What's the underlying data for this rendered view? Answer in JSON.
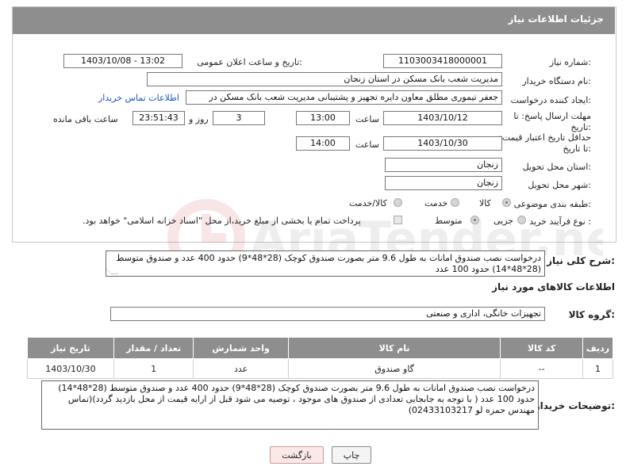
{
  "header": {
    "title": "جزئیات اطلاعات نیاز"
  },
  "fields": {
    "need_number_label": "شماره نیاز:",
    "need_number": "1103003418000001",
    "announce_label": "تاریخ و ساعت اعلان عمومی:",
    "announce_value": "1403/10/08 - 13:02",
    "buyer_label": "نام دستگاه خریدار:",
    "buyer_value": "مدیریت شعب بانک مسکن در استان زنجان",
    "creator_label": "ایجاد کننده درخواست:",
    "creator_value": "جعفر تیموری مطلق معاون دایره تجهیز و پشتیبانی مدیریت شعب بانک مسکن در",
    "contact_link": "اطلاعات تماس خریدار",
    "deadline_label": "مهلت ارسال پاسخ: تا تاریخ:",
    "deadline_date": "1403/10/12",
    "time_label": "ساعت",
    "deadline_time": "13:00",
    "days_value": "3",
    "days_label": "روز و",
    "remaining_time": "23:51:43",
    "remaining_label": "ساعت باقی مانده",
    "validity_label": "حداقل تاریخ اعتبار قیمت: تا تاریخ:",
    "validity_date": "1403/10/30",
    "validity_time": "14:00",
    "province_label": "استان محل تحویل:",
    "province_value": "زنجان",
    "city_label": "شهر محل تحویل:",
    "city_value": "زنجان",
    "category_label": "طبقه بندی موضوعی:",
    "category_options": [
      "کالا",
      "خدمت",
      "کالا/خدمت"
    ],
    "category_selected": "کالا",
    "process_label": "نوع فرآیند خرید :",
    "process_options": [
      "جزیی",
      "متوسط"
    ],
    "process_selected": "متوسط",
    "payment_note": "پرداخت تمام یا بخشی از مبلغ خرید،از محل \"اسناد خزانه اسلامی\" خواهد بود."
  },
  "summary": {
    "label": "شرح کلی نیاز:",
    "text": "درخواست نصب صندوق امانات به طول 9.6 متر بصورت صندوق کوچک (28*48*9) حدود 400 عدد و صندوق متوسط (28*48*14) حدود 100 عدد"
  },
  "goods_info_title": "اطلاعات کالاهای مورد نیاز",
  "goods_group": {
    "label": "گروه کالا:",
    "value": "تجهیزات خانگی، اداری و صنعتی"
  },
  "table": {
    "headers": [
      "ردیف",
      "کد کالا",
      "نام کالا",
      "واحد شمارش",
      "تعداد / مقدار",
      "تاریخ نیاز"
    ],
    "rows": [
      [
        "1",
        "--",
        "گاو صندوق",
        "عدد",
        "1",
        "1403/10/30"
      ]
    ]
  },
  "buyer_notes": {
    "label": "توضیحات خریدار:",
    "text": "درخواست نصب صندوق امانات به طول 9.6 متر بصورت صندوق کوچک (28*48*9) حدود 400 عدد و صندوق متوسط (28*48*14) حدود 100 عدد ( با توجه به جابجایی تعدادی از صندوق های موجود ، توصیه می شود قبل از ارایه قیمت از محل بازدید گردد)(تماس مهندس حمزه لو 02433103217)"
  },
  "buttons": {
    "print": "چاپ",
    "back": "بازگشت"
  },
  "watermark": {
    "text": "AriaTender.net"
  }
}
